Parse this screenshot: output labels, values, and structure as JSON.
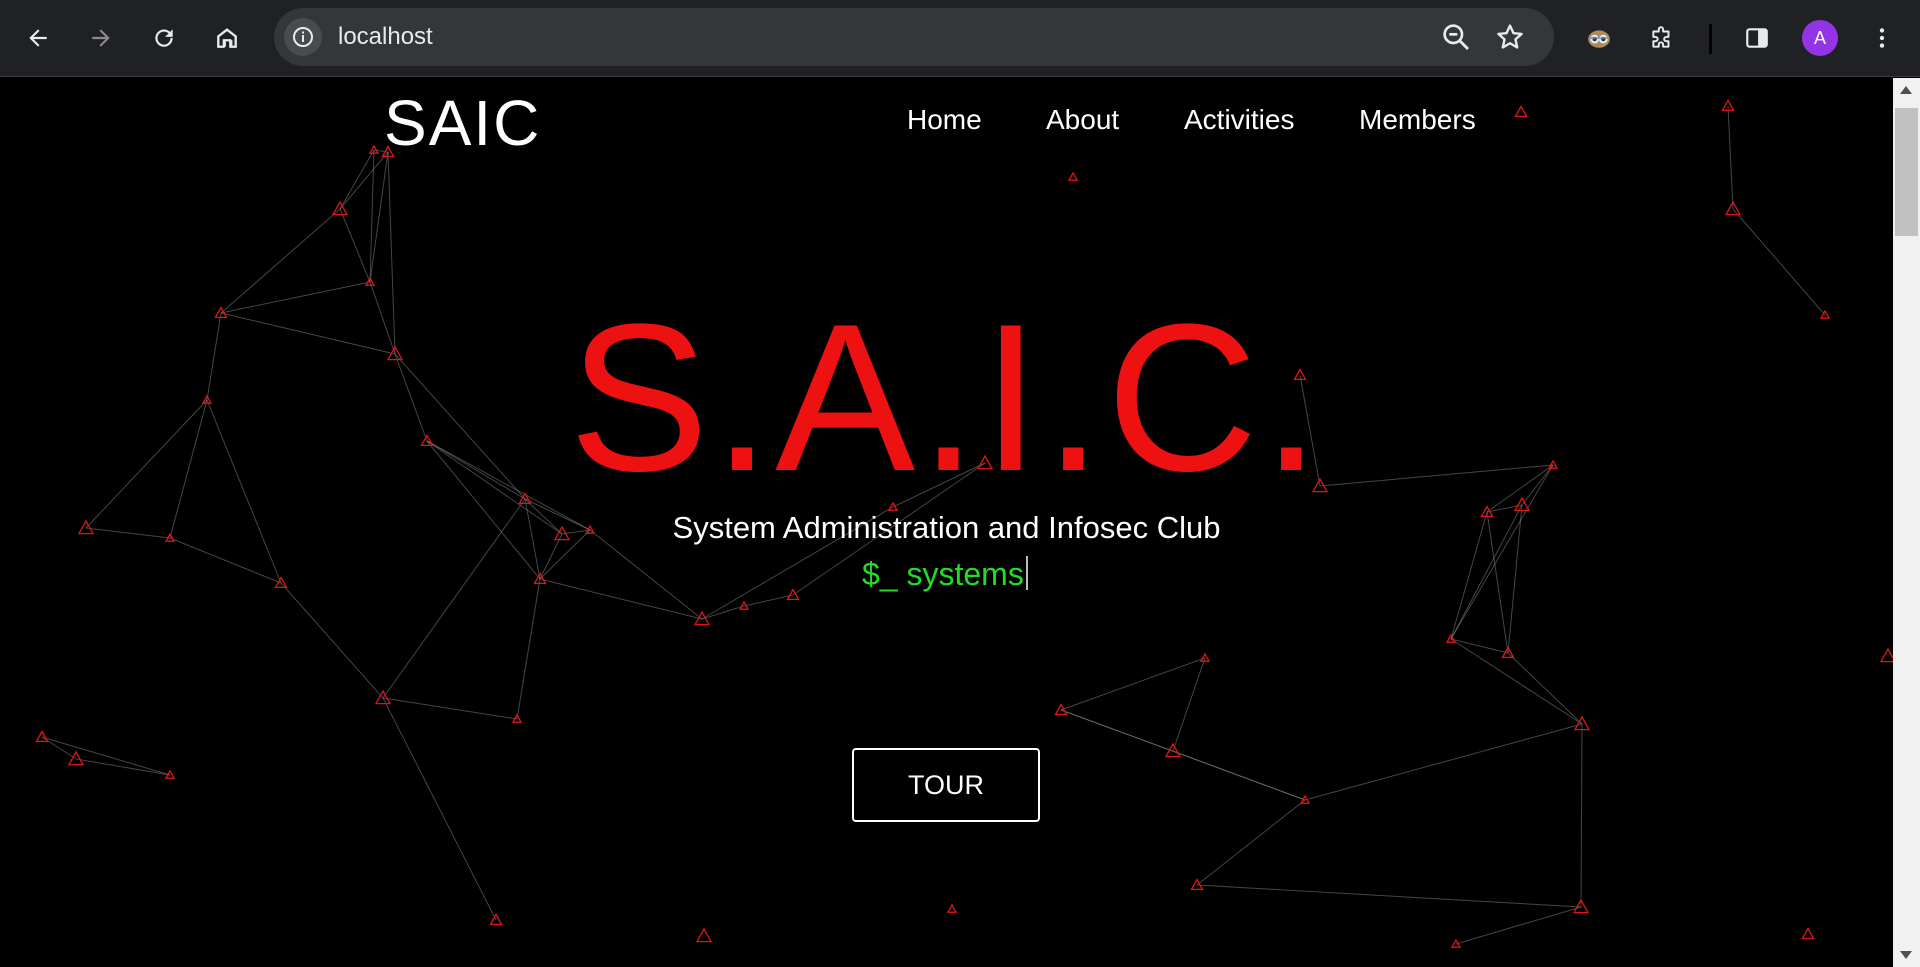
{
  "browser": {
    "url": "localhost",
    "profile_initial": "A",
    "icons": [
      "back-arrow-icon",
      "forward-arrow-icon",
      "reload-icon",
      "home-icon",
      "site-info-icon",
      "zoom-out-icon",
      "bookmark-star-icon",
      "extension-owl-icon",
      "puzzle-extensions-icon",
      "side-panel-icon",
      "menu-kebab-icon"
    ]
  },
  "site": {
    "brand": "SAIC",
    "nav": [
      {
        "label": "Home"
      },
      {
        "label": "About"
      },
      {
        "label": "Activities"
      },
      {
        "label": "Members"
      }
    ]
  },
  "hero": {
    "title": "S.A.I.C.",
    "subtitle": "System Administration and Infosec Club",
    "typed_prompt": "$_ systems",
    "tour_button": "TOUR"
  },
  "colors": {
    "accent_red": "#ee1111",
    "terminal_green": "#22dd22",
    "background": "#000000"
  }
}
